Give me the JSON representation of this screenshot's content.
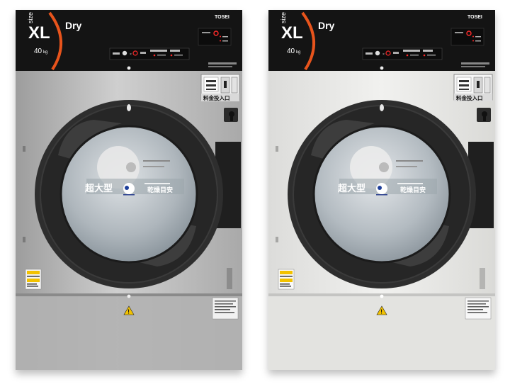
{
  "machines": [
    {
      "finish": "stainless",
      "body_color": "#b9b9b9",
      "size_caption": "size",
      "size_label": "XL",
      "mode_label": "Dry",
      "capacity": "40",
      "capacity_unit": "kg",
      "brand": "TOSEI",
      "coin_slot_label": "料金投入口",
      "window_big_label": "超大型",
      "window_small_label": "乾燥目安"
    },
    {
      "finish": "white",
      "body_color": "#e9e9e6",
      "size_caption": "size",
      "size_label": "XL",
      "mode_label": "Dry",
      "capacity": "40",
      "capacity_unit": "kg",
      "brand": "TOSEI",
      "coin_slot_label": "料金投入口",
      "window_big_label": "超大型",
      "window_small_label": "乾燥目安"
    }
  ],
  "colors": {
    "panel_black": "#141414",
    "accent_orange": "#e8541c",
    "door_ring": "#2e2e2e",
    "warning_yellow": "#f2c200"
  }
}
